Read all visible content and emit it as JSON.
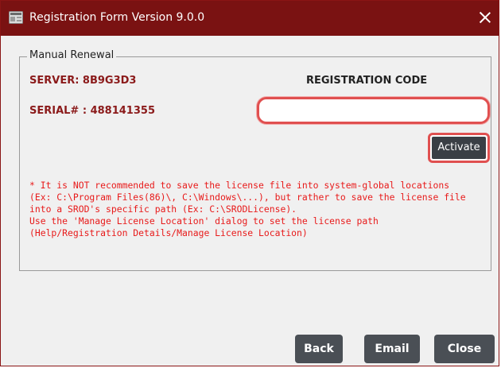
{
  "window": {
    "title": "Registration Form Version 9.0.0",
    "accent_color": "#7a1212"
  },
  "manual_renewal": {
    "legend": "Manual Renewal",
    "server_label": "SERVER: 8B9G3D3",
    "serial_label": "SERIAL# : 488141355",
    "registration_code_label": "REGISTRATION CODE",
    "registration_code_value": "",
    "activate_label": "Activate",
    "note": "* It is NOT recommended to save the license file into system-global locations\n(Ex: C:\\Program Files(86)\\, C:\\Windows\\...), but rather to save the license file\ninto a SROD's specific path (Ex: C:\\SRODLicense).\nUse the 'Manage License Location' dialog to set the license path\n(Help/Registration Details/Manage License Location)"
  },
  "footer": {
    "back_label": "Back",
    "email_label": "Email",
    "close_label": "Close"
  }
}
